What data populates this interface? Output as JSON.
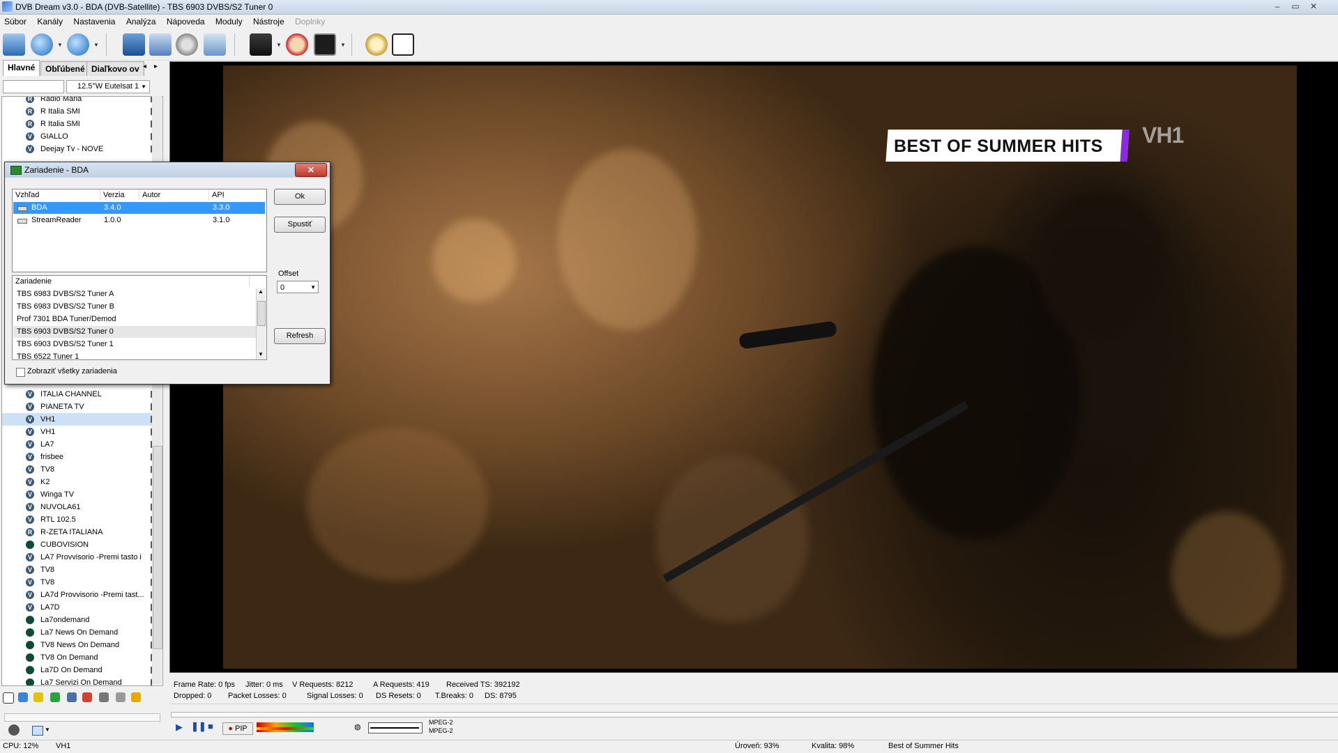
{
  "window": {
    "title": "DVB Dream v3.0 - BDA (DVB-Satellite)  -  TBS 6903 DVBS/S2 Tuner 0",
    "controls": [
      "–",
      "▭",
      "✕"
    ]
  },
  "menu": [
    "Súbor",
    "Kanály",
    "Nastavenia",
    "Analýza",
    "Nápoveda",
    "Moduly",
    "Nástroje",
    "Doplnky"
  ],
  "left_panel": {
    "tabs": [
      "Hlavné",
      "Obľúbené",
      "Diaľkovo ov"
    ],
    "tab_arrows": [
      "◂",
      "▸"
    ],
    "satellite": "12.5°W Eutelsat 1",
    "channels": [
      {
        "name": "Radio Maria",
        "icon": "r"
      },
      {
        "name": "R Italia SMI",
        "icon": "r"
      },
      {
        "name": "R Italia SMI",
        "icon": "r"
      },
      {
        "name": "GIALLO",
        "icon": "v"
      },
      {
        "name": "Deejay Tv - NOVE",
        "icon": "v"
      },
      {
        "name": "ITALIA CHANNEL",
        "icon": "v"
      },
      {
        "name": "PIANETA TV",
        "icon": "v"
      },
      {
        "name": "VH1",
        "icon": "v"
      },
      {
        "name": "VH1",
        "icon": "v"
      },
      {
        "name": "LA7",
        "icon": "v"
      },
      {
        "name": "frisbee",
        "icon": "v"
      },
      {
        "name": "TV8",
        "icon": "v"
      },
      {
        "name": "K2",
        "icon": "v"
      },
      {
        "name": "Winga TV",
        "icon": "v"
      },
      {
        "name": "NUVOLA61",
        "icon": "v"
      },
      {
        "name": "RTL 102.5",
        "icon": "v"
      },
      {
        "name": "R-ZETA ITALIANA",
        "icon": "r"
      },
      {
        "name": "CUBOVISION",
        "icon": "g"
      },
      {
        "name": "LA7 Provvisorio -Premi tasto i",
        "icon": "v"
      },
      {
        "name": "TV8",
        "icon": "v"
      },
      {
        "name": "TV8",
        "icon": "v"
      },
      {
        "name": "LA7d Provvisorio -Premi tast...",
        "icon": "v"
      },
      {
        "name": "LA7D",
        "icon": "v"
      },
      {
        "name": "La7ondemand",
        "icon": "g"
      },
      {
        "name": "La7 News On Demand",
        "icon": "g"
      },
      {
        "name": "TV8 News On Demand",
        "icon": "g"
      },
      {
        "name": "TV8 On Demand",
        "icon": "g"
      },
      {
        "name": "La7D On Demand",
        "icon": "g"
      },
      {
        "name": "La7 Servizi On Demand",
        "icon": "g"
      }
    ]
  },
  "video": {
    "banner": "BEST OF SUMMER HITS",
    "channel_logo": "VH1"
  },
  "stats": {
    "frame_rate": "Frame Rate: 0 fps",
    "jitter": "Jitter: 0 ms",
    "v_requests": "V Requests: 8212",
    "a_requests": "A Requests: 419",
    "received_ts": "Received TS: 392192",
    "dropped": "Dropped: 0",
    "packet_losses": "Packet Losses: 0",
    "signal_losses": "Signal Losses: 0",
    "ds_resets": "DS Resets: 0",
    "t_breaks": "T.Breaks: 0",
    "ds": "DS: 8795"
  },
  "player": {
    "pip": "PIP",
    "codec_video": "MPEG-2",
    "codec_audio": "MPEG-2"
  },
  "statusbar": {
    "cpu": "CPU: 12%",
    "channel": "VH1",
    "level": "Úroveň: 93%",
    "quality": "Kvalita: 98%",
    "program": "Best of Summer Hits"
  },
  "dialog": {
    "title": "Zariadenie - BDA",
    "close": "✕",
    "columns": [
      "Vzhľad",
      "Verzia",
      "Autor",
      "API"
    ],
    "plugins": [
      {
        "name": "BDA",
        "version": "3.4.0",
        "author": "",
        "api": "3.3.0"
      },
      {
        "name": "StreamReader",
        "version": "1.0.0",
        "author": "",
        "api": "3.1.0"
      }
    ],
    "devices_header": "Zariadenie",
    "devices": [
      "TBS 6983 DVBS/S2 Tuner A",
      "TBS 6983 DVBS/S2 Tuner B",
      "Prof 7301 BDA Tuner/Demod",
      "TBS 6903 DVBS/S2 Tuner 0",
      "TBS 6903 DVBS/S2 Tuner 1",
      "TBS 6522 Tuner 1"
    ],
    "ok_label": "Ok",
    "start_label": "Spustiť",
    "offset_label": "Offset",
    "offset_value": "0",
    "refresh_label": "Refresh",
    "show_all_label": "Zobraziť všetky zariadenia"
  }
}
